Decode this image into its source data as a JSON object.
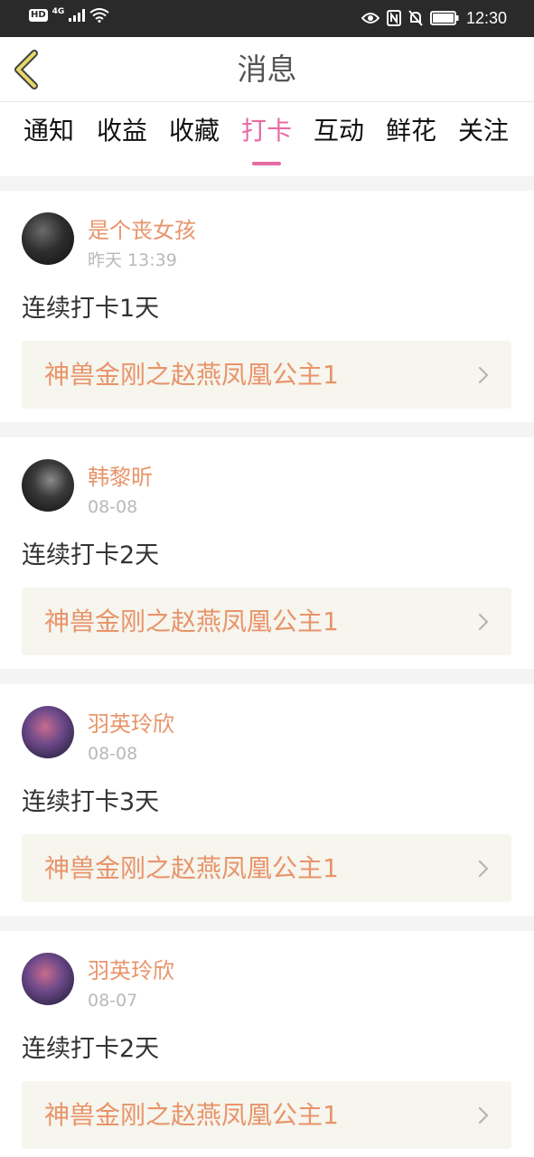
{
  "status_bar": {
    "hd": "HD",
    "network": "4G",
    "time": "12:30"
  },
  "header": {
    "title": "消息"
  },
  "tabs": [
    {
      "label": "通知",
      "active": false
    },
    {
      "label": "收益",
      "active": false
    },
    {
      "label": "收藏",
      "active": false
    },
    {
      "label": "打卡",
      "active": true
    },
    {
      "label": "互动",
      "active": false
    },
    {
      "label": "鲜花",
      "active": false
    },
    {
      "label": "关注",
      "active": false
    }
  ],
  "feed": {
    "items": [
      {
        "user": "是个丧女孩",
        "time": "昨天 13:39",
        "text": "连续打卡1天",
        "book": "神兽金刚之赵燕凤凰公主1"
      },
      {
        "user": "韩黎昕",
        "time": "08-08",
        "text": "连续打卡2天",
        "book": "神兽金刚之赵燕凤凰公主1"
      },
      {
        "user": "羽英玲欣",
        "time": "08-08",
        "text": "连续打卡3天",
        "book": "神兽金刚之赵燕凤凰公主1"
      },
      {
        "user": "羽英玲欣",
        "time": "08-07",
        "text": "连续打卡2天",
        "book": "神兽金刚之赵燕凤凰公主1"
      }
    ]
  },
  "colors": {
    "accent": "#e86aa3",
    "username": "#e8946a",
    "book_bg": "#f6f5ee",
    "back_arrow": "#e8d86a"
  }
}
